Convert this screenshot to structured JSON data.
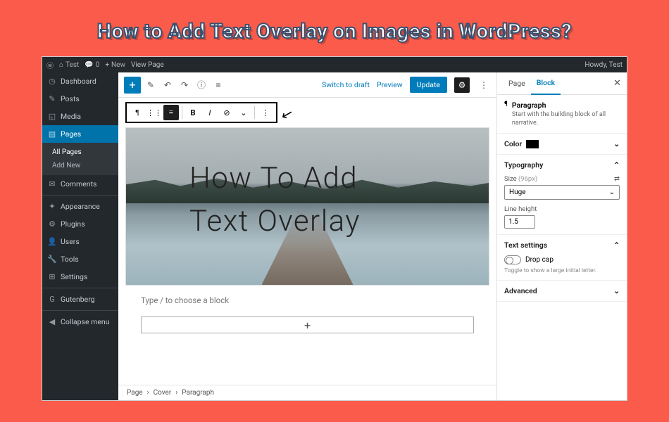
{
  "title": "How to Add Text Overlay on Images in WordPress?",
  "adminbar": {
    "site": "Test",
    "comments": "0",
    "new": "New",
    "view": "View Page",
    "howdy": "Howdy, Test"
  },
  "sidebar": {
    "items": [
      {
        "icon": "◷",
        "label": "Dashboard"
      },
      {
        "icon": "✎",
        "label": "Posts"
      },
      {
        "icon": "◱",
        "label": "Media"
      },
      {
        "icon": "▤",
        "label": "Pages",
        "active": true
      },
      {
        "icon": "✉",
        "label": "Comments"
      },
      {
        "icon": "✦",
        "label": "Appearance"
      },
      {
        "icon": "⚙",
        "label": "Plugins"
      },
      {
        "icon": "👤",
        "label": "Users"
      },
      {
        "icon": "🔧",
        "label": "Tools"
      },
      {
        "icon": "⊞",
        "label": "Settings"
      },
      {
        "icon": "G",
        "label": "Gutenberg"
      }
    ],
    "sub": {
      "all": "All Pages",
      "add": "Add New"
    },
    "collapse": "Collapse menu"
  },
  "toolbar": {
    "switch": "Switch to draft",
    "preview": "Preview",
    "update": "Update"
  },
  "cover": {
    "line1": "How To Add",
    "line2": "Text Overlay"
  },
  "placeholder": "Type / to choose a block",
  "breadcrumbs": [
    "Page",
    "Cover",
    "Paragraph"
  ],
  "panel": {
    "tabs": {
      "page": "Page",
      "block": "Block"
    },
    "para": {
      "title": "Paragraph",
      "desc": "Start with the building block of all narrative."
    },
    "color": {
      "title": "Color"
    },
    "typo": {
      "title": "Typography",
      "size_label": "Size",
      "size_hint": "(96px)",
      "value": "Huge",
      "lh_label": "Line height",
      "lh_value": "1.5"
    },
    "text": {
      "title": "Text settings",
      "dropcap": "Drop cap",
      "hint": "Toggle to show a large initial letter."
    },
    "adv": {
      "title": "Advanced"
    }
  }
}
